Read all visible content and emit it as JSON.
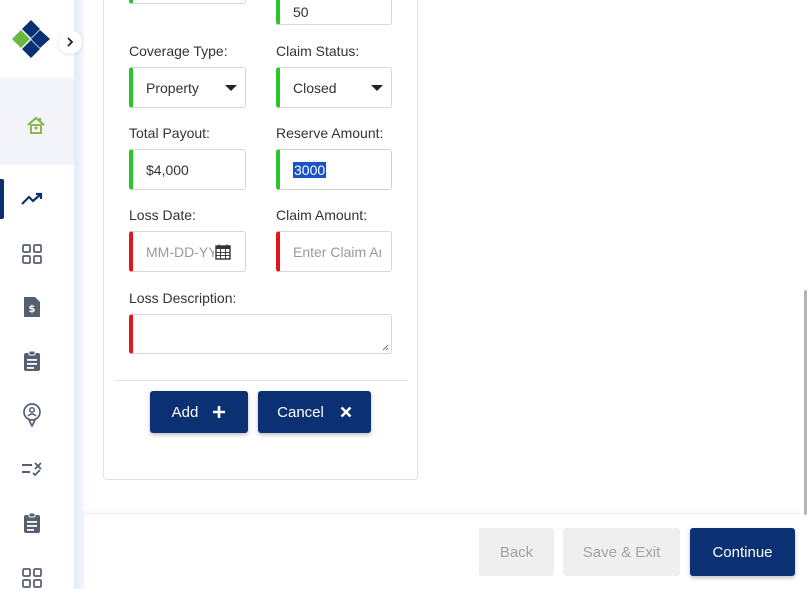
{
  "partial_top_value": "50",
  "form": {
    "coverage_type": {
      "label": "Coverage Type:",
      "value": "Property"
    },
    "claim_status": {
      "label": "Claim Status:",
      "value": "Closed"
    },
    "total_payout": {
      "label": "Total Payout:",
      "value": "$4,000"
    },
    "reserve_amount": {
      "label": "Reserve Amount:",
      "value": "3000"
    },
    "loss_date": {
      "label": "Loss Date:",
      "placeholder": "MM-DD-YYYY"
    },
    "claim_amount": {
      "label": "Claim Amount:",
      "placeholder": "Enter Claim Amount"
    },
    "loss_description": {
      "label": "Loss Description:",
      "value": ""
    },
    "add_label": "Add",
    "cancel_label": "Cancel"
  },
  "footer": {
    "back_label": "Back",
    "save_exit_label": "Save & Exit",
    "continue_label": "Continue"
  },
  "sidebar": {
    "icons": [
      "home-icon",
      "trending-icon",
      "grid-icon",
      "invoice-icon",
      "clipboard-icon",
      "location-pin-icon",
      "checklist-icon",
      "clipboard-icon",
      "grid-icon"
    ]
  },
  "colors": {
    "brand_navy": "#0b3074",
    "valid_green": "#2bc42b",
    "required_red": "#e8141c",
    "logo_green": "#6ab83f"
  }
}
